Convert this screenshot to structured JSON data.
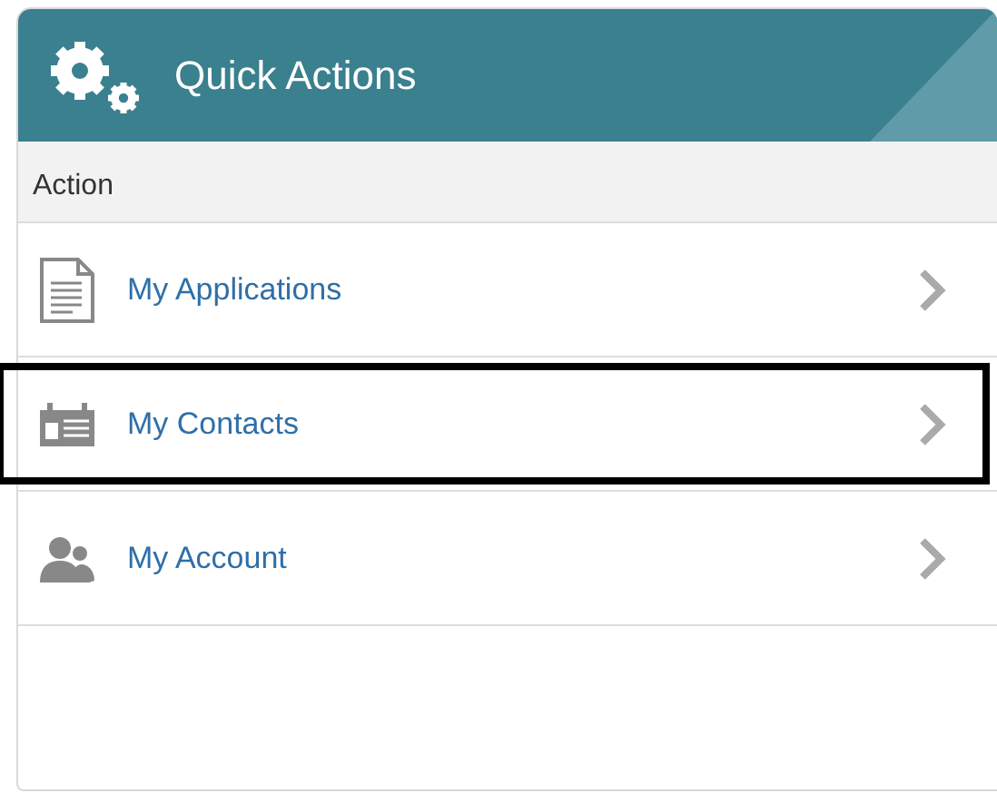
{
  "panel": {
    "title": "Quick Actions"
  },
  "table": {
    "columns": [
      "Action"
    ],
    "rows": [
      {
        "label": "My Applications",
        "kind": "document",
        "highlighted": false
      },
      {
        "label": "My Contacts",
        "kind": "card",
        "highlighted": true
      },
      {
        "label": "My Account",
        "kind": "people",
        "highlighted": false
      }
    ]
  }
}
